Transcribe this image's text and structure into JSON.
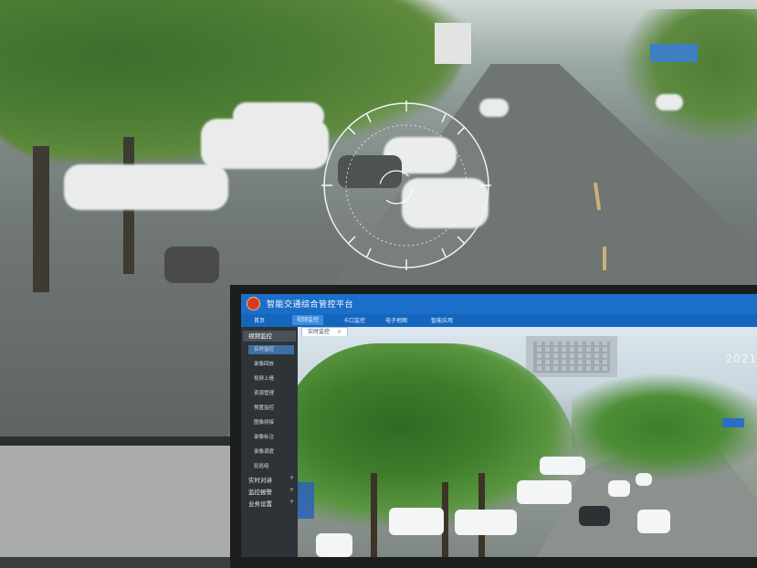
{
  "app": {
    "title": "智能交通综合管控平台"
  },
  "nav": {
    "items": [
      "首页",
      "视频监控",
      "卡口监控",
      "电子地图",
      "智能应用"
    ],
    "active_index": 1
  },
  "tabs": [
    {
      "label": "实时监控",
      "close": "×"
    }
  ],
  "sidebar": {
    "header": "视频监控",
    "sub_items": [
      "实时监控",
      "录像回放",
      "视频上墙",
      "资源管理",
      "预置监控",
      "图像拼接",
      "录像标注",
      "录像调度",
      "轮巡组"
    ],
    "active_sub_index": 0,
    "groups": [
      {
        "label": "实时对讲",
        "chevron": "+"
      },
      {
        "label": "监控报警",
        "chevron": "+"
      },
      {
        "label": "业务设置",
        "chevron": "+"
      }
    ]
  },
  "video": {
    "timestamp": "2021"
  },
  "colors": {
    "titlebar": "#1c6fc9",
    "navbar": "#1466bd",
    "sidebar": "#2e3338",
    "active_highlight": "#3e6fa6"
  }
}
